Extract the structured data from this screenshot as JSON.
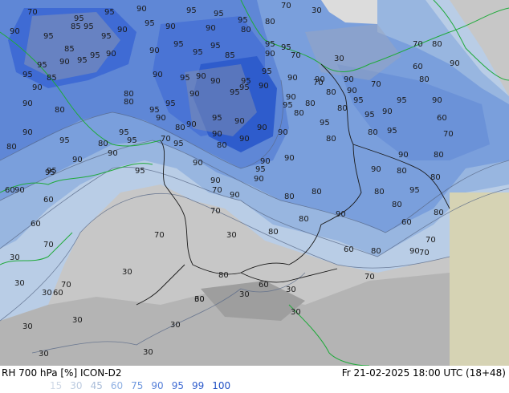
{
  "footer": {
    "title": "RH 700 hPa [%] ICON-D2",
    "datetime": "Fr 21-02-2025 18:00 UTC (18+48)"
  },
  "legend": {
    "items": [
      {
        "label": "15",
        "color": "#cfd8e6"
      },
      {
        "label": "30",
        "color": "#bccbe0"
      },
      {
        "label": "45",
        "color": "#a9bdd9"
      },
      {
        "label": "60",
        "color": "#8fb0e3"
      },
      {
        "label": "75",
        "color": "#6f98de"
      },
      {
        "label": "90",
        "color": "#557fd8"
      },
      {
        "label": "95",
        "color": "#3f6bd4"
      },
      {
        "label": "99",
        "color": "#2e5ccc"
      },
      {
        "label": "100",
        "color": "#1f4fc4"
      }
    ]
  },
  "map": {
    "contour_labels": [
      "70",
      "95",
      "85",
      "95",
      "90",
      "95",
      "95",
      "95",
      "80",
      "70",
      "30",
      "90",
      "95",
      "95",
      "95",
      "95",
      "90",
      "90",
      "90",
      "80",
      "95",
      "85",
      "95",
      "95",
      "90",
      "95",
      "95",
      "90",
      "90",
      "95",
      "95",
      "85",
      "90",
      "95",
      "70",
      "95",
      "85",
      "90",
      "95",
      "90",
      "90",
      "95",
      "95",
      "90",
      "90",
      "30",
      "60",
      "90",
      "80",
      "95",
      "90",
      "95",
      "90",
      "90",
      "95",
      "95",
      "90",
      "70",
      "90",
      "80",
      "95",
      "80",
      "90",
      "70",
      "80",
      "90",
      "70",
      "80",
      "80",
      "95",
      "90",
      "80",
      "90",
      "95",
      "95",
      "90",
      "80",
      "80",
      "95",
      "90",
      "90",
      "95",
      "90",
      "95",
      "90",
      "90",
      "90",
      "90",
      "80",
      "95",
      "80",
      "80",
      "90",
      "95",
      "95",
      "70",
      "80",
      "90",
      "90",
      "80",
      "95",
      "90",
      "80",
      "95",
      "90",
      "90",
      "95",
      "90",
      "80",
      "70",
      "60",
      "95",
      "95",
      "90",
      "90",
      "80",
      "80",
      "90",
      "80",
      "95",
      "60",
      "70",
      "90",
      "80",
      "90",
      "80",
      "90",
      "70",
      "60",
      "70",
      "80",
      "80",
      "80",
      "80",
      "60",
      "30",
      "70",
      "80",
      "60",
      "30",
      "70",
      "80",
      "60",
      "70",
      "70",
      "30",
      "30",
      "60",
      "70",
      "60",
      "30",
      "60",
      "30",
      "30",
      "30",
      "30",
      "30",
      "30",
      "30",
      "30",
      "30"
    ]
  }
}
